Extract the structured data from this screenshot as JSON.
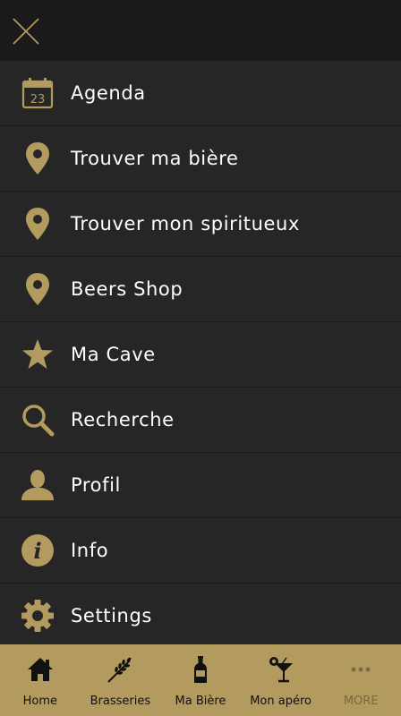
{
  "colors": {
    "accent": "#b39a5e",
    "background": "#262626",
    "topbar": "#1a1a1a"
  },
  "calendar_day": "23",
  "menu": [
    {
      "label": "Agenda",
      "icon": "calendar-icon"
    },
    {
      "label": "Trouver ma bière",
      "icon": "map-pin-icon"
    },
    {
      "label": "Trouver mon spiritueux",
      "icon": "map-pin-icon"
    },
    {
      "label": "Beers Shop",
      "icon": "map-pin-icon"
    },
    {
      "label": "Ma Cave",
      "icon": "star-icon"
    },
    {
      "label": "Recherche",
      "icon": "search-icon"
    },
    {
      "label": "Profil",
      "icon": "user-icon"
    },
    {
      "label": "Info",
      "icon": "info-icon"
    },
    {
      "label": "Settings",
      "icon": "gear-icon"
    }
  ],
  "tabs": [
    {
      "label": "Home",
      "icon": "home-icon"
    },
    {
      "label": "Brasseries",
      "icon": "wheat-icon"
    },
    {
      "label": "Ma Bière",
      "icon": "bottle-icon"
    },
    {
      "label": "Mon apéro",
      "icon": "cocktail-icon"
    },
    {
      "label": "MORE",
      "icon": "more-icon"
    }
  ]
}
